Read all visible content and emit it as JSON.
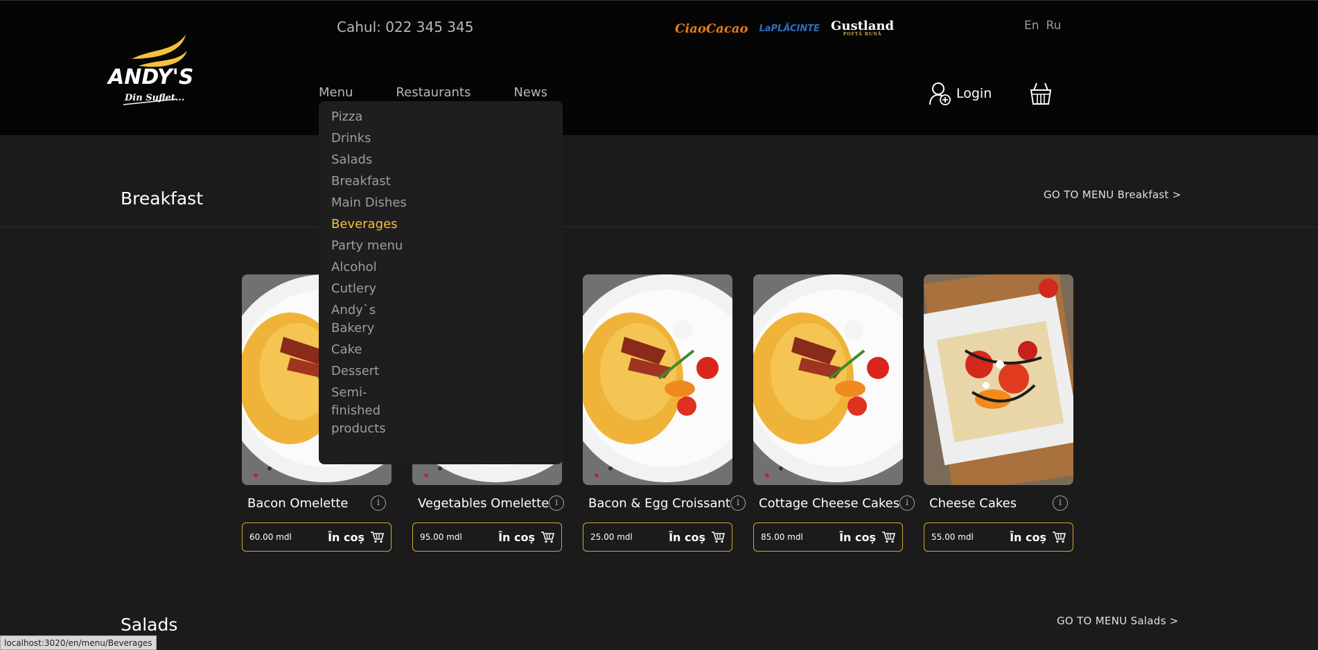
{
  "header": {
    "logo": {
      "brand": "ANDY'S",
      "tagline": "Din Suflet..."
    },
    "phone": "Cahul: 022 345 345",
    "partners": [
      {
        "name": "CiaoCacao"
      },
      {
        "name": "LaPLĂCINTE"
      },
      {
        "name": "Gustland",
        "tagline": "POFTĂ BUNĂ"
      }
    ],
    "languages": [
      "En",
      "Ru"
    ],
    "nav": [
      "Menu",
      "Restaurants",
      "News"
    ],
    "login_label": "Login"
  },
  "dropdown": {
    "items": [
      "Pizza",
      "Drinks",
      "Salads",
      "Breakfast",
      "Main Dishes",
      "Beverages",
      "Party menu",
      "Alcohol",
      "Cutlery",
      "Andy`s Bakery",
      "Cake",
      "Dessert",
      "Semi-finished products"
    ],
    "active_item": "Beverages"
  },
  "sections": {
    "breakfast": {
      "title": "Breakfast",
      "link": "GO TO MENU Breakfast >"
    },
    "salads": {
      "title": "Salads",
      "link": "GO TO MENU Salads >"
    }
  },
  "products": [
    {
      "name": "Bacon Omelette",
      "price": "60.00 mdl",
      "cta": "În coș"
    },
    {
      "name": "Vegetables Omelette",
      "price": "95.00 mdl",
      "cta": "În coș"
    },
    {
      "name": "Bacon & Egg Croissant",
      "price": "25.00 mdl",
      "cta": "În coș"
    },
    {
      "name": "Cottage Cheese Cakes",
      "price": "85.00 mdl",
      "cta": "În coș"
    },
    {
      "name": "Cheese Cakes",
      "price": "55.00 mdl",
      "cta": "În coș"
    }
  ],
  "status_bar": "localhost:3020/en/menu/Beverages",
  "colors": {
    "accent": "#f5c13b",
    "card_border": "#d9a531",
    "header_bg": "#050505",
    "page_bg": "#1b1b1b"
  }
}
